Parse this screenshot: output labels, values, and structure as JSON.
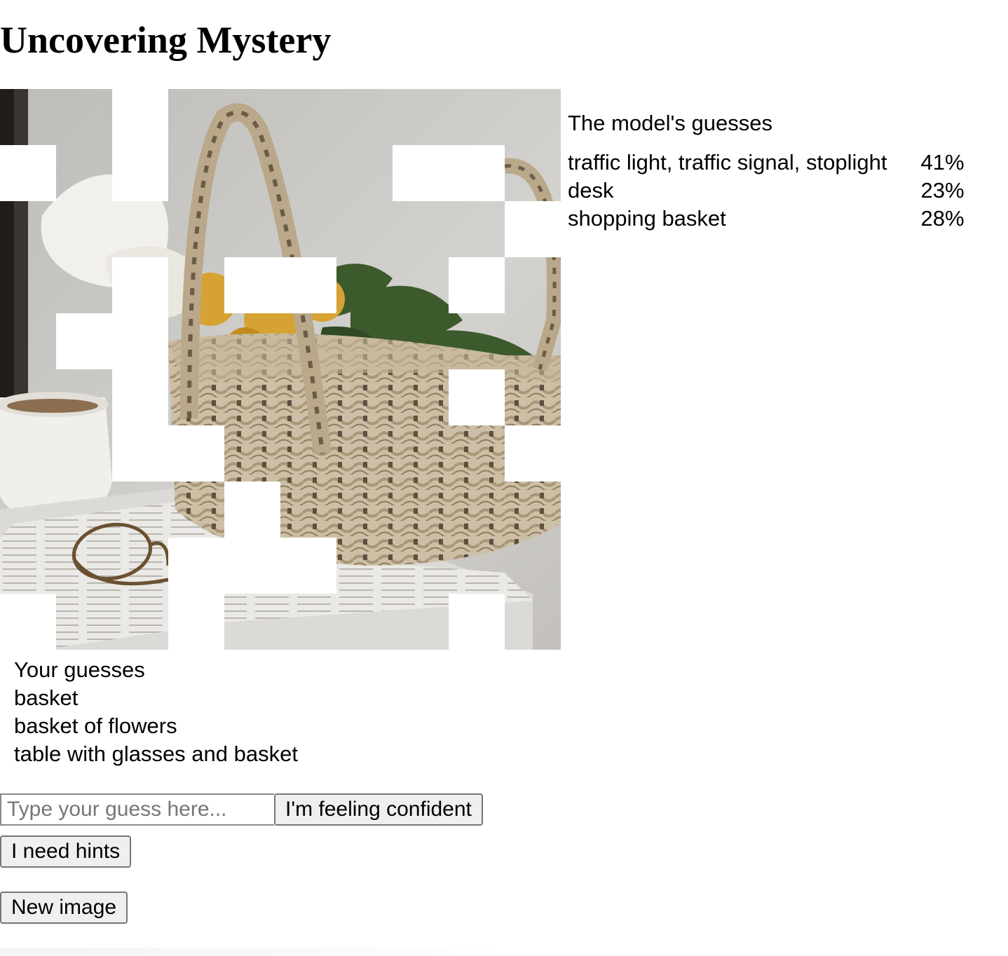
{
  "page": {
    "title": "Uncovering Mystery"
  },
  "puzzle": {
    "grid": {
      "rows": 10,
      "cols": 10
    },
    "hidden_tiles": [
      [
        0,
        2
      ],
      [
        1,
        0
      ],
      [
        1,
        2
      ],
      [
        1,
        7
      ],
      [
        1,
        8
      ],
      [
        2,
        9
      ],
      [
        3,
        2
      ],
      [
        3,
        4
      ],
      [
        3,
        5
      ],
      [
        3,
        8
      ],
      [
        4,
        1
      ],
      [
        4,
        2
      ],
      [
        5,
        2
      ],
      [
        5,
        8
      ],
      [
        6,
        2
      ],
      [
        6,
        3
      ],
      [
        6,
        9
      ],
      [
        7,
        4
      ],
      [
        8,
        3
      ],
      [
        8,
        4
      ],
      [
        8,
        5
      ],
      [
        9,
        0
      ],
      [
        9,
        3
      ],
      [
        9,
        8
      ]
    ]
  },
  "model_guesses": {
    "heading": "The model's guesses",
    "items": [
      {
        "label": "traffic light, traffic signal, stoplight",
        "percent": "41%"
      },
      {
        "label": "desk",
        "percent": "23%"
      },
      {
        "label": "shopping basket",
        "percent": "28%"
      }
    ]
  },
  "user_guesses": {
    "heading": "Your guesses",
    "items": [
      "basket",
      "basket of flowers",
      "table with glasses and basket"
    ]
  },
  "controls": {
    "input_placeholder": "Type your guess here...",
    "input_value": "",
    "confident_label": "I'm feeling confident",
    "hints_label": "I need hints",
    "new_image_label": "New image"
  }
}
